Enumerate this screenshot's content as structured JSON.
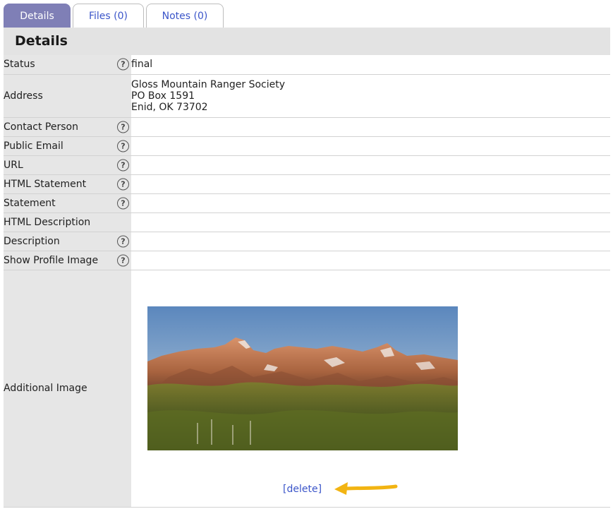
{
  "tabs": [
    {
      "label": "Details",
      "active": true
    },
    {
      "label": "Files (0)",
      "active": false
    },
    {
      "label": "Notes (0)",
      "active": false
    }
  ],
  "section_title": "Details",
  "fields": {
    "status": {
      "label": "Status",
      "value": "final"
    },
    "address": {
      "label": "Address",
      "lines": [
        "Gloss Mountain Ranger Society",
        "PO Box 1591",
        "Enid, OK 73702"
      ]
    },
    "contact_person": {
      "label": "Contact Person",
      "value": ""
    },
    "public_email": {
      "label": "Public Email",
      "value": ""
    },
    "url": {
      "label": "URL",
      "value": ""
    },
    "html_statement": {
      "label": "HTML Statement",
      "value": ""
    },
    "statement": {
      "label": "Statement",
      "value": ""
    },
    "html_description": {
      "label": "HTML Description",
      "value": ""
    },
    "description": {
      "label": "Description",
      "value": ""
    },
    "show_profile_image": {
      "label": "Show Profile Image",
      "value": ""
    },
    "additional_image": {
      "label": "Additional Image",
      "delete_label": "[delete]"
    }
  },
  "help_glyph": "?",
  "colors": {
    "active_tab": "#7f7fb6",
    "link": "#3b55c9",
    "label_bg": "#e6e6e6",
    "arrow": "#f2b412"
  },
  "icons": {
    "help": "question-circle-icon",
    "arrow": "left-arrow-annotation-icon"
  }
}
